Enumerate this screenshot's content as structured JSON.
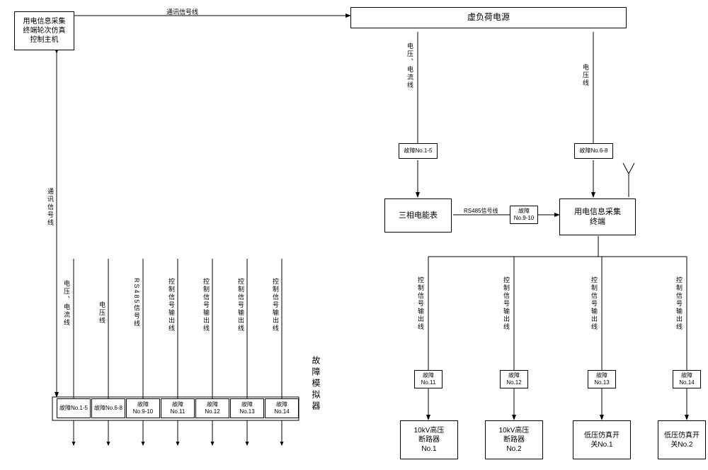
{
  "boxes": {
    "control_host": "用电信息采集\n终端轮次仿真\n控制主机",
    "virtual_load": "虚负荷电源",
    "three_phase": "三相电能表",
    "collect_terminal": "用电信息采集\n终端",
    "breaker_10kv_1": "10kV高压\n断路器\nNo.1",
    "breaker_10kv_2": "10kV高压\n断路器\nNo.2",
    "lv_switch_1": "低压仿真开\n关No.1",
    "lv_switch_2": "低压仿真开\n关No.2"
  },
  "faults": {
    "f1_5": "故障No.1-5",
    "f6_8": "故障No.6-8",
    "f9_10": "故障\nNo.9-10",
    "f11": "故障\nNo.11",
    "f12": "故障\nNo.12",
    "f13": "故障\nNo.13",
    "f14": "故障\nNo.14",
    "f1_5_b": "故障No.1-5",
    "f6_8_b": "故障No.6-8",
    "f9_10_b": "故障\nNo.9-10",
    "f11_b": "故障\nNo.11",
    "f12_b": "故障\nNo.12",
    "f13_b": "故障\nNo.13",
    "f14_b": "故障\nNo.14"
  },
  "labels": {
    "comm_line": "通讯信号线",
    "comm_line_v": "通讯信号线",
    "volt_curr": "电压、电流线",
    "volt_line": "电压线",
    "rs485": "RS485信号线",
    "ctrl_out": "控制信号输出线",
    "fault_sim": "故障模拟器"
  }
}
